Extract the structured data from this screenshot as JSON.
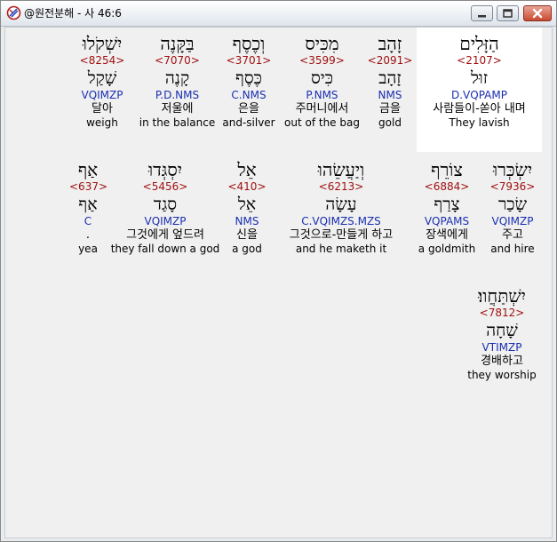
{
  "window": {
    "title": "@원전분해 - 사 46:6",
    "controls": {
      "minimize": "minimize",
      "maximize": "maximize",
      "close": "close"
    }
  },
  "rows": [
    [
      {
        "heb": "הַזָּלִים",
        "num": "<2107>",
        "root": "זוּל",
        "morph": "D.VQPAMP",
        "kor": "사람들이-쏟아 내며",
        "eng": "They lavish",
        "highlight": true
      },
      {
        "heb": "זָהָב",
        "num": "<2091>",
        "root": "זָהָב",
        "morph": "NMS",
        "kor": "금을",
        "eng": "gold"
      },
      {
        "heb": "מִכִּיס",
        "num": "<3599>",
        "root": "כִּיס",
        "morph": "P.NMS",
        "kor": "주머니에서",
        "eng": "out of the bag"
      },
      {
        "heb": "וְכֶסֶף",
        "num": "<3701>",
        "root": "כֶּסֶף",
        "morph": "C.NMS",
        "kor": "은을",
        "eng": "and-silver"
      },
      {
        "heb": "בַּקָּנֶה",
        "num": "<7070>",
        "root": "קָנֶה",
        "morph": "P.D.NMS",
        "kor": "저울에",
        "eng": "in the balance"
      },
      {
        "heb": "יִשְׁקֹלוּ",
        "num": "<8254>",
        "root": "שָׁקַל",
        "morph": "VQIMZP",
        "kor": "달아",
        "eng": "weigh"
      }
    ],
    [
      {
        "heb": "יִשְׂכְּרוּ",
        "num": "<7936>",
        "root": "שָׂכַר",
        "morph": "VQIMZP",
        "kor": "주고",
        "eng": "and hire"
      },
      {
        "heb": "צוֹרֵף",
        "num": "<6884>",
        "root": "צָרַף",
        "morph": "VQPAMS",
        "kor": "장색에게",
        "eng": "a goldmith"
      },
      {
        "heb": "וְיַעֲשֵׂהוּ",
        "num": "<6213>",
        "root": "עָשָׂה",
        "morph": "C.VQIMZS.MZS",
        "kor": "그것으로-만들게 하고",
        "eng": "and he maketh it"
      },
      {
        "heb": "אֵל",
        "num": "<410>",
        "root": "אֵל",
        "morph": "NMS",
        "kor": "신을",
        "eng": "a god"
      },
      {
        "heb": "יִסְגְּדוּ",
        "num": "<5456>",
        "root": "סָגַד",
        "morph": "VQIMZP",
        "kor": "그것에게 엎드려",
        "eng": "they fall down a god"
      },
      {
        "heb": "אַף",
        "num": "<637>",
        "root": "אַף",
        "morph": "C",
        "kor": ".",
        "eng": "yea"
      }
    ],
    [
      {
        "heb": "יִשְׁתַּחֲווּ׃",
        "num": "<7812>",
        "root": "שָׁחָה",
        "morph": "VTIMZP",
        "kor": "경배하고",
        "eng": "they worship"
      }
    ]
  ]
}
